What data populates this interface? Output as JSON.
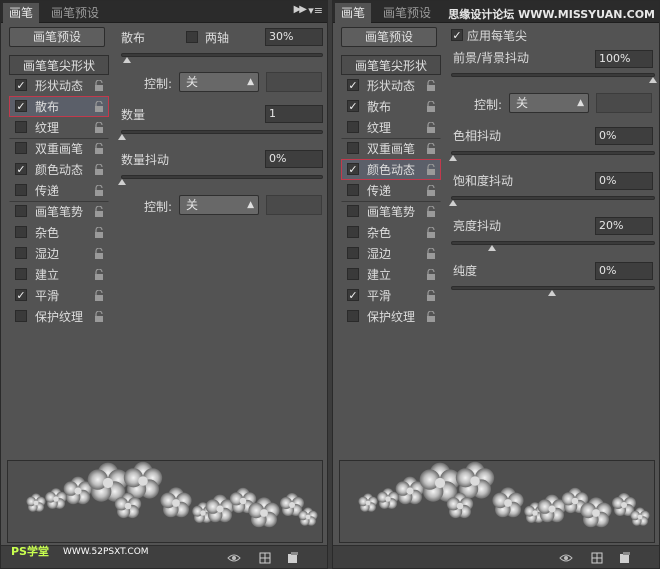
{
  "left": {
    "tabs": [
      {
        "label": "画笔"
      },
      {
        "label": "画笔预设"
      }
    ],
    "preset_button": "画笔预设",
    "list_header": "画笔笔尖形状",
    "items": [
      {
        "label": "形状动态",
        "checked": "✓"
      },
      {
        "label": "散布",
        "checked": "✓"
      },
      {
        "label": "纹理",
        "checked": ""
      },
      {
        "label": "双重画笔",
        "checked": ""
      },
      {
        "label": "颜色动态",
        "checked": "✓"
      },
      {
        "label": "传递",
        "checked": ""
      },
      {
        "label": "画笔笔势",
        "checked": ""
      },
      {
        "label": "杂色",
        "checked": ""
      },
      {
        "label": "湿边",
        "checked": ""
      },
      {
        "label": "建立",
        "checked": ""
      },
      {
        "label": "平滑",
        "checked": "✓"
      },
      {
        "label": "保护纹理",
        "checked": ""
      }
    ],
    "selected_index": 1,
    "settings": {
      "scatter_label": "散布",
      "both_axes_label": "两轴",
      "scatter_value": "30%",
      "control_label": "控制:",
      "control_value": "关",
      "count_label": "数量",
      "count_value": "1",
      "count_jitter_label": "数量抖动",
      "count_jitter_value": "0%",
      "control2_label": "控制:",
      "control2_value": "关"
    }
  },
  "right": {
    "tabs": [
      {
        "label": "画笔"
      },
      {
        "label": "画笔预设"
      }
    ],
    "preset_button": "画笔预设",
    "list_header": "画笔笔尖形状",
    "items": [
      {
        "label": "形状动态",
        "checked": "✓"
      },
      {
        "label": "散布",
        "checked": "✓"
      },
      {
        "label": "纹理",
        "checked": ""
      },
      {
        "label": "双重画笔",
        "checked": ""
      },
      {
        "label": "颜色动态",
        "checked": "✓"
      },
      {
        "label": "传递",
        "checked": ""
      },
      {
        "label": "画笔笔势",
        "checked": ""
      },
      {
        "label": "杂色",
        "checked": ""
      },
      {
        "label": "湿边",
        "checked": ""
      },
      {
        "label": "建立",
        "checked": ""
      },
      {
        "label": "平滑",
        "checked": "✓"
      },
      {
        "label": "保护纹理",
        "checked": ""
      }
    ],
    "selected_index": 4,
    "settings": {
      "apply_per_tip_label": "应用每笔尖",
      "apply_per_tip_checked": "✓",
      "fg_bg_label": "前景/背景抖动",
      "fg_bg_value": "100%",
      "control_label": "控制:",
      "control_value": "关",
      "hue_label": "色相抖动",
      "hue_value": "0%",
      "saturation_label": "饱和度抖动",
      "saturation_value": "0%",
      "brightness_label": "亮度抖动",
      "brightness_value": "20%",
      "purity_label": "纯度",
      "purity_value": "0%"
    }
  },
  "watermark": "思缘设计论坛 WWW.MISSYUAN.COM",
  "logo": "PS学堂",
  "logo_url": "WWW.52PSXT.COM",
  "colors": {
    "selection_border": "#c2394c",
    "panel_bg": "#535353"
  }
}
